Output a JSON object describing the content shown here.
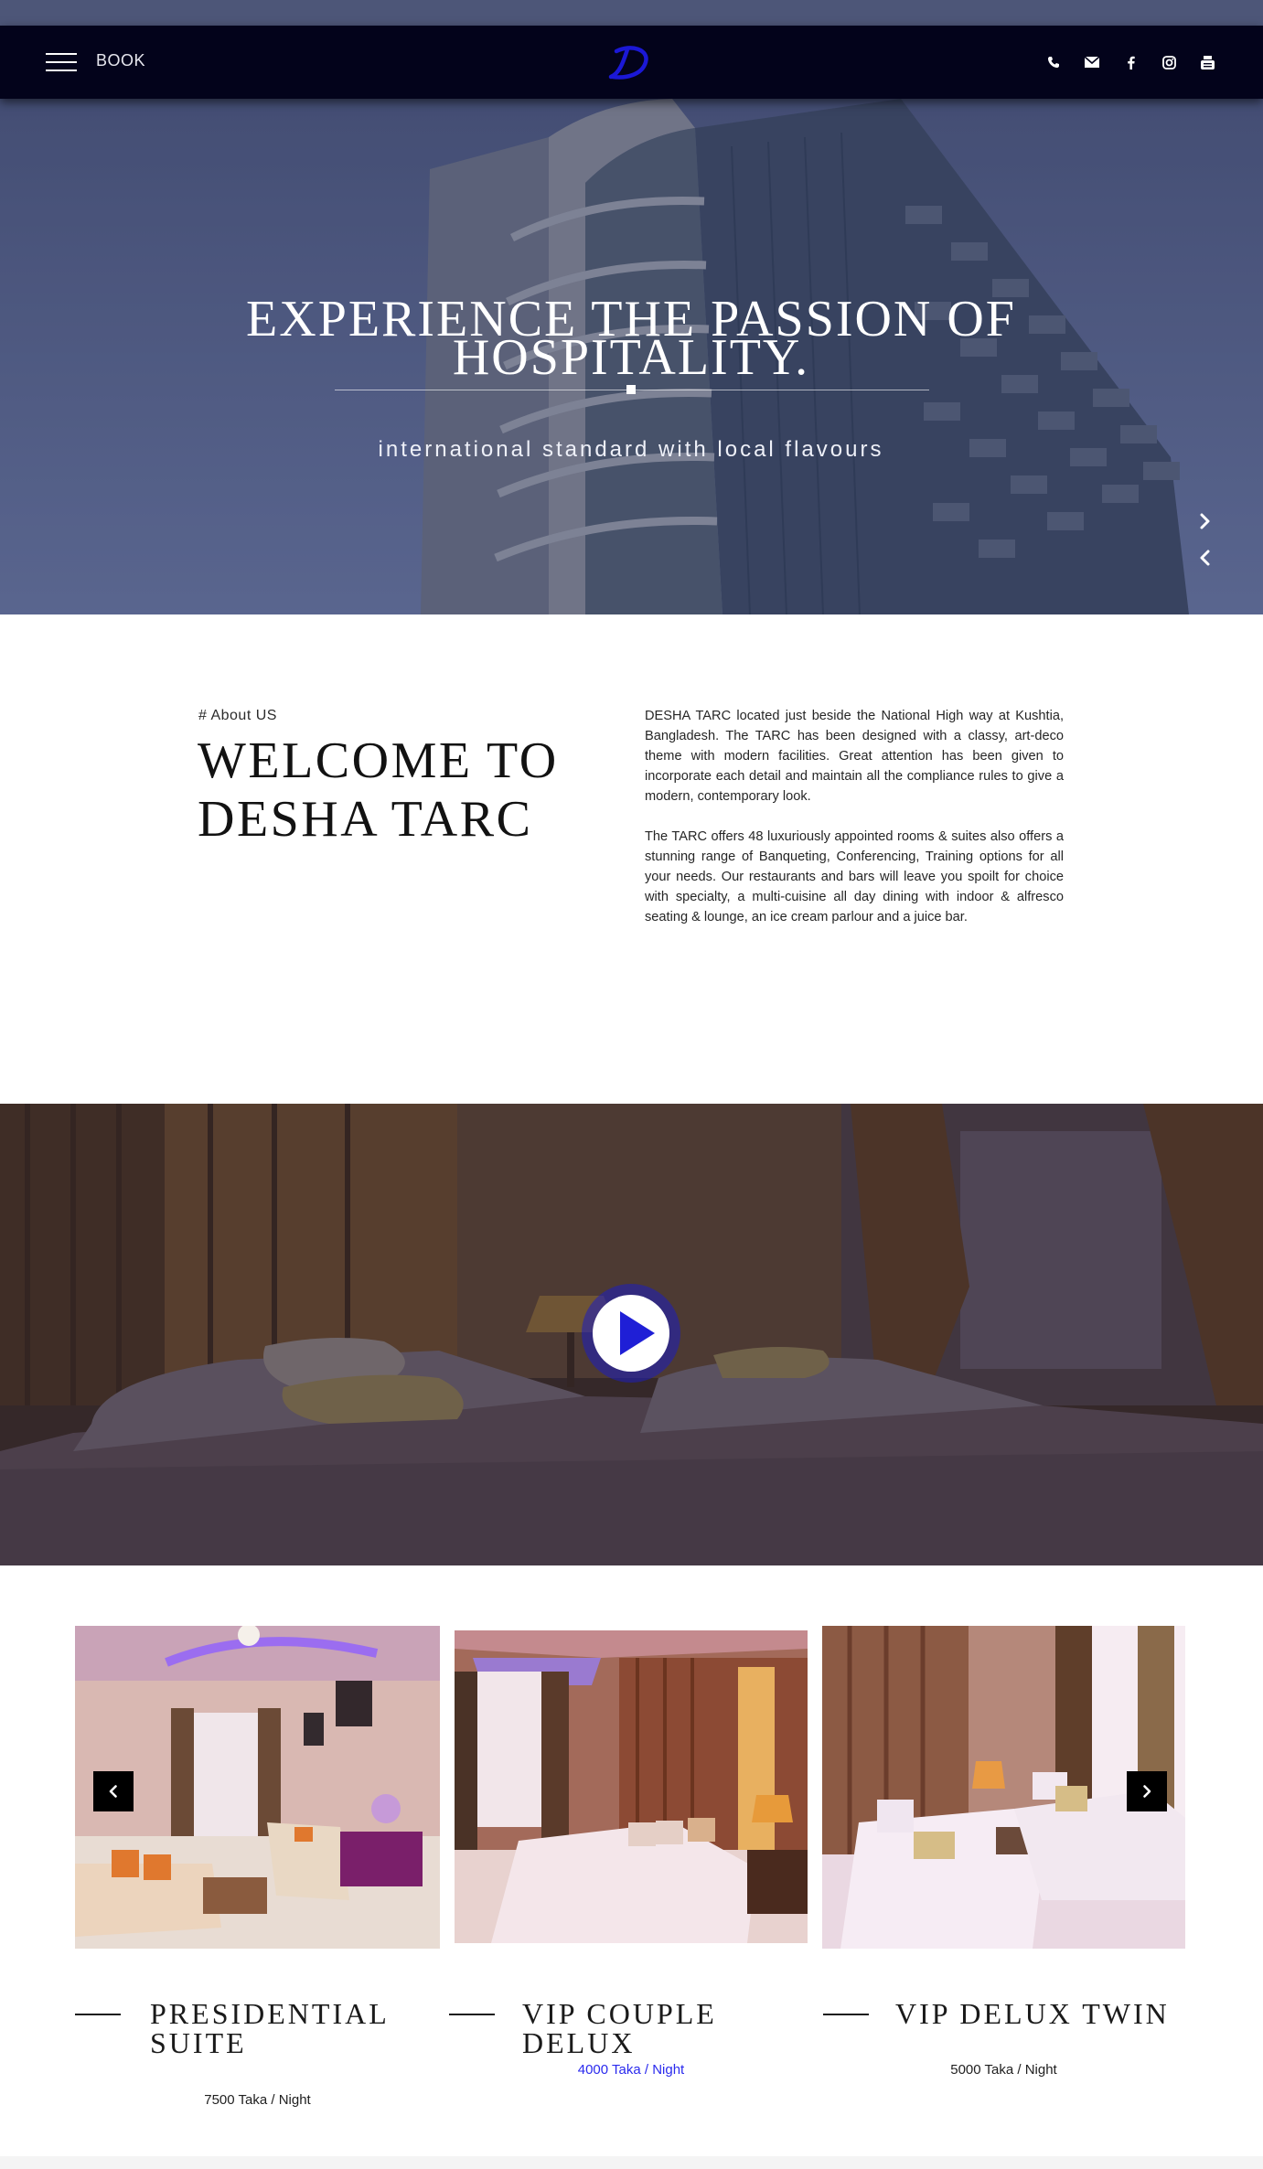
{
  "header": {
    "book_label": "BOOK",
    "logo_letter": "D",
    "social_icons": [
      "phone-icon",
      "envelope-icon",
      "facebook-icon",
      "instagram-icon",
      "youtube-icon"
    ]
  },
  "hero": {
    "title_line1": "EXPERIENCE THE PASSION OF",
    "title_line2": "HOSPITALITY.",
    "subtitle": "international standard with local flavours"
  },
  "about": {
    "eyebrow": "# About US",
    "title_line1": "WELCOME TO",
    "title_line2": "DESHA TARC",
    "paragraph1": "DESHA TARC located just beside the National High way at Kushtia, Bangladesh. The TARC has been designed with a classy, art-deco theme with modern facilities. Great attention has been given to incorporate each detail and maintain all the compliance rules to give a modern, contemporary look.",
    "paragraph2": "The TARC offers 48 luxuriously appointed rooms & suites also offers a stunning range of Banqueting, Conferencing, Training options for all your needs. Our restaurants and bars will leave you spoilt for choice with specialty, a multi-cuisine all day dining with indoor & alfresco seating & lounge, an ice cream parlour and a juice bar."
  },
  "rooms": [
    {
      "name_line1": "PRESIDENTIAL",
      "name_line2": "SUITE",
      "price": "7500 Taka / Night"
    },
    {
      "name_line1": "VIP COUPLE DELUX",
      "name_line2": "",
      "price": "4000 Taka / Night"
    },
    {
      "name_line1": "VIP DELUX TWIN",
      "name_line2": "",
      "price": "5000 Taka / Night"
    }
  ],
  "colors": {
    "navbar": "#03031b",
    "accent_blue": "#2a2aee",
    "play_button": "#1f1fd6"
  }
}
